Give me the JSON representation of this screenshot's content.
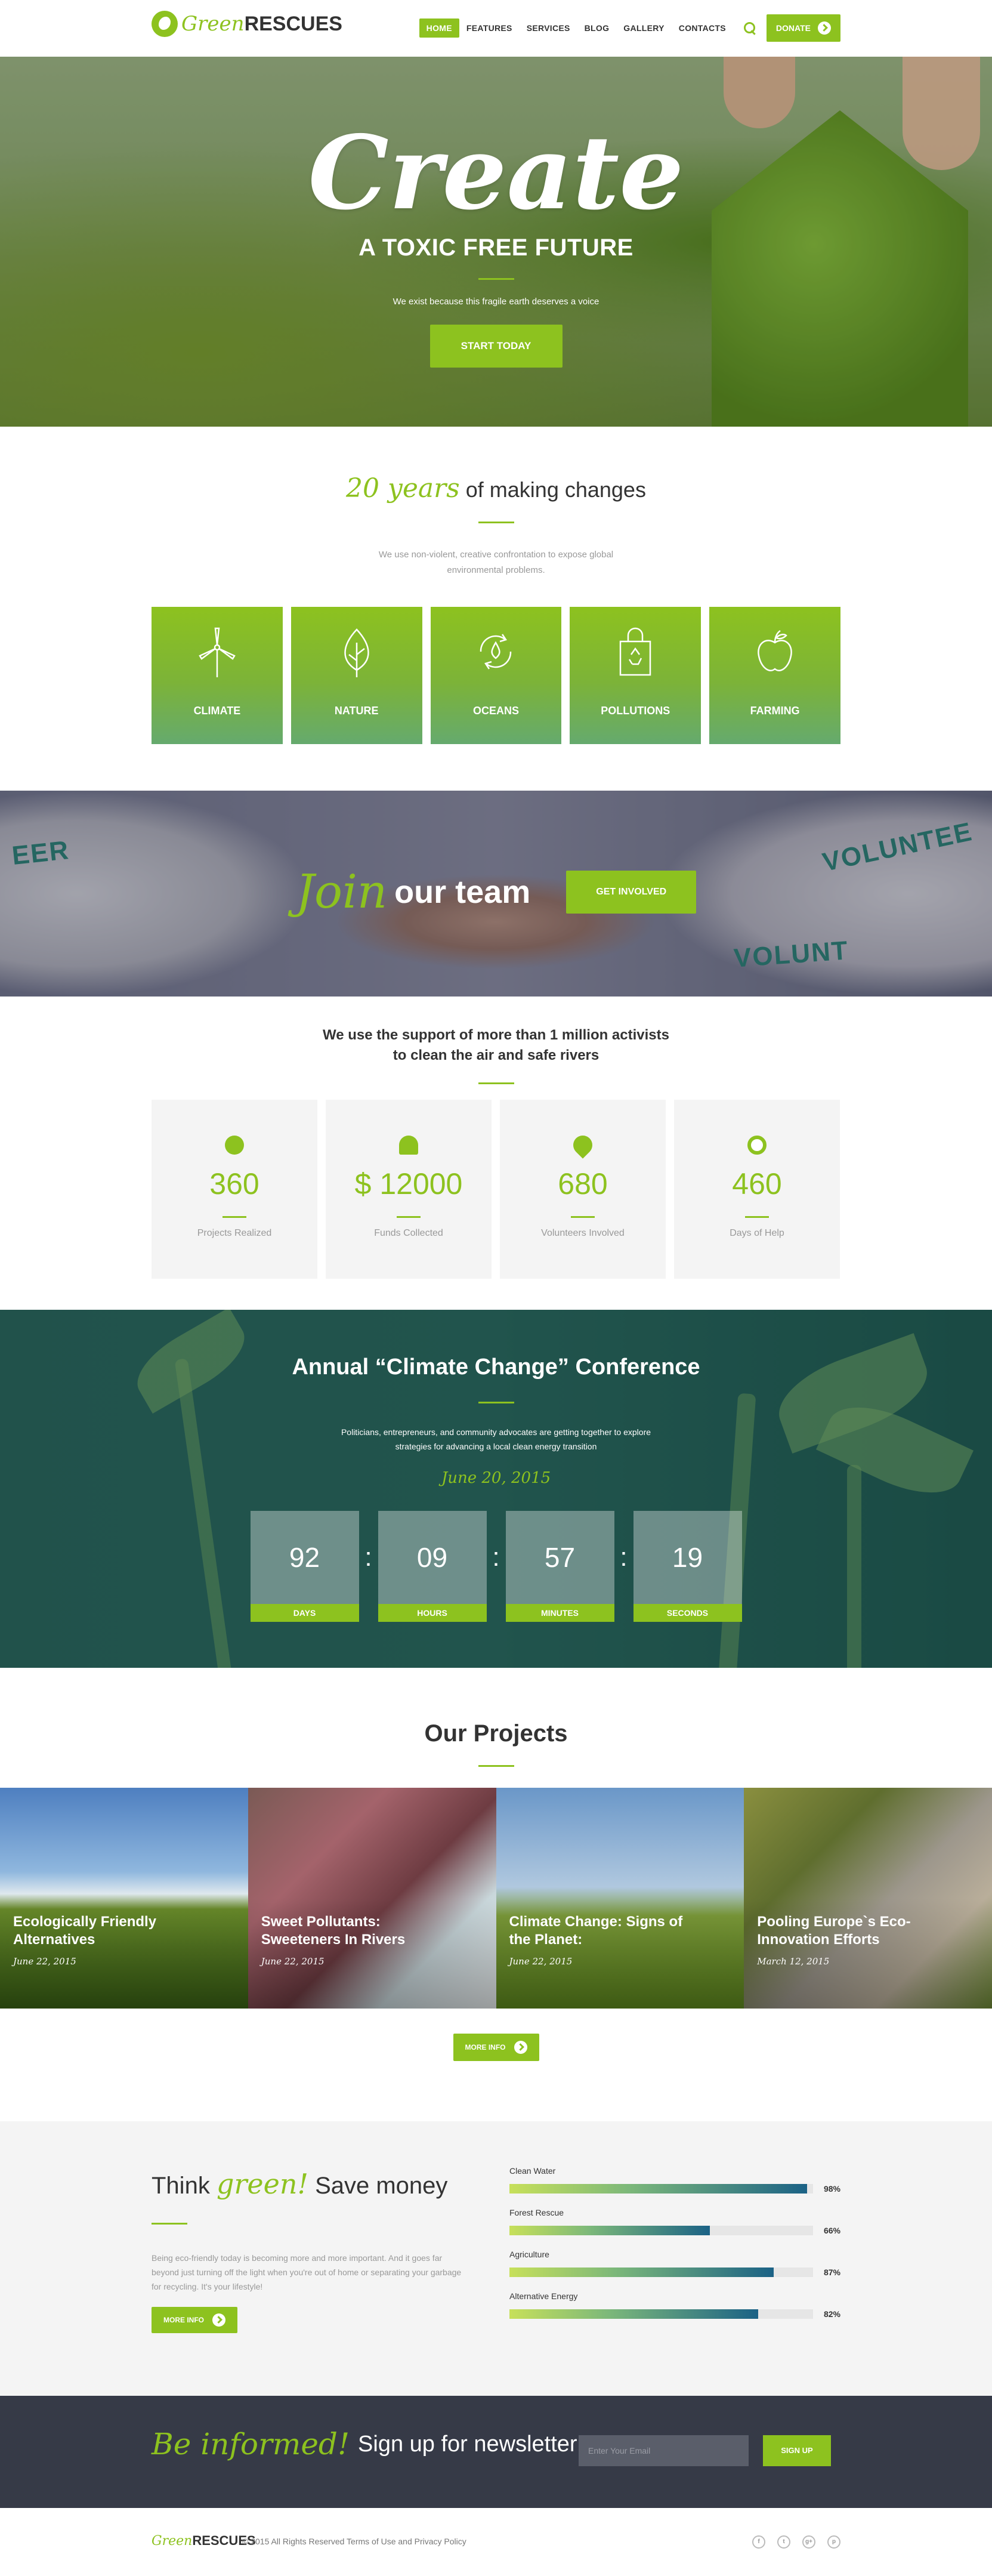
{
  "header": {
    "logo_green": "Green",
    "logo_rest": "RESCUES",
    "nav": [
      "HOME",
      "FEATURES",
      "SERVICES",
      "BLOG",
      "GALLERY",
      "CONTACTS"
    ],
    "donate": "DONATE"
  },
  "hero": {
    "title": "Create",
    "subtitle": "A TOXIC FREE FUTURE",
    "text": "We exist because this fragile earth deserves a voice",
    "button": "START TODAY"
  },
  "about": {
    "title_script": "20 years",
    "title_rest": "of making changes",
    "text": "We use non-violent, creative confrontation to expose global environmental problems.",
    "tiles": [
      {
        "label": "CLIMATE",
        "icon": "wind-turbine-icon"
      },
      {
        "label": "NATURE",
        "icon": "leaf-icon"
      },
      {
        "label": "OCEANS",
        "icon": "recycle-drop-icon"
      },
      {
        "label": "POLLUTIONS",
        "icon": "recycle-bag-icon"
      },
      {
        "label": "FARMING",
        "icon": "apple-icon"
      }
    ]
  },
  "join": {
    "script": "Join",
    "rest": "our team",
    "button": "GET INVOLVED"
  },
  "stats": {
    "heading_line1": "We use the support of more than 1 million activists",
    "heading_line2": "to clean the air and safe rivers",
    "items": [
      {
        "value": "360",
        "label": "Projects Realized",
        "icon": "globe-icon"
      },
      {
        "value": "$ 12000",
        "label": "Funds Collected",
        "icon": "plant-icon"
      },
      {
        "value": "680",
        "label": "Volunteers Involved",
        "icon": "balloon-icon"
      },
      {
        "value": "460",
        "label": "Days of Help",
        "icon": "cycle-icon"
      }
    ]
  },
  "conference": {
    "title": "Annual “Climate Change” Conference",
    "text_line1": "Politicians, entrepreneurs, and community advocates are getting together to explore",
    "text_line2": "strategies for advancing a local clean energy transition",
    "date": "June 20, 2015",
    "countdown": [
      {
        "value": "92",
        "label": "DAYS"
      },
      {
        "value": "09",
        "label": "HOURS"
      },
      {
        "value": "57",
        "label": "MINUTES"
      },
      {
        "value": "19",
        "label": "SECONDS"
      }
    ]
  },
  "projects": {
    "title": "Our Projects",
    "items": [
      {
        "title": "Ecologically Friendly Alternatives",
        "date": "June 22, 2015"
      },
      {
        "title": "Sweet Pollutants: Sweeteners In Rivers",
        "date": "June 22, 2015"
      },
      {
        "title": "Climate Change: Signs of the Planet:",
        "date": "June 22, 2015"
      },
      {
        "title": "Pooling Europe`s Eco-Innovation Efforts",
        "date": "March 12, 2015"
      }
    ],
    "button": "MORE INFO"
  },
  "think": {
    "title_a": "Think",
    "title_script": "green!",
    "title_b": "Save money",
    "text": "Being eco-friendly today is becoming more and more important. And it goes far beyond just turning off the light when you're out of home or separating your garbage for recycling. It's your lifestyle!",
    "button": "MORE INFO",
    "bars": [
      {
        "label": "Clean Water",
        "value": 98,
        "text": "98%"
      },
      {
        "label": "Forest Rescue",
        "value": 66,
        "text": "66%"
      },
      {
        "label": "Agriculture",
        "value": 87,
        "text": "87%"
      },
      {
        "label": "Alternative Energy",
        "value": 82,
        "text": "82%"
      }
    ]
  },
  "newsletter": {
    "script": "Be informed!",
    "rest": "Sign up for newsletter",
    "placeholder": "Enter Your Email",
    "button": "SIGN UP"
  },
  "footer": {
    "logo_green": "Green",
    "logo_rest": "RESCUES",
    "copyright": "© 2015 All Rights Reserved Terms of Use and Privacy Policy",
    "socials": [
      "f",
      "t",
      "g+",
      "p"
    ]
  },
  "colors": {
    "accent": "#8dc21f",
    "dark": "#363a47"
  }
}
